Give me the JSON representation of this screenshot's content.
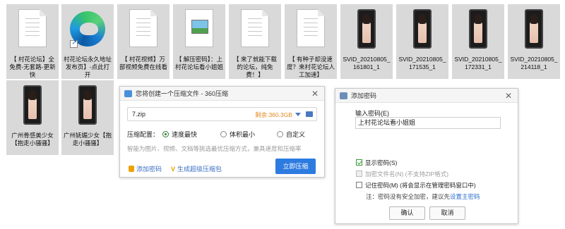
{
  "files": [
    {
      "label": "【 村花论坛】全免费-无套路-更新快",
      "kind": "doc"
    },
    {
      "label": "村花论坛永久地址发布页】-点此打开",
      "kind": "edge"
    },
    {
      "label": "【 村花视频】万部视频免费在线看",
      "kind": "doc"
    },
    {
      "label": "【 解压密码】：上村花论坛看小姐姐",
      "kind": "image"
    },
    {
      "label": "【 来了就能下载的论坛，纯免费！】",
      "kind": "doc"
    },
    {
      "label": "【 有种子却没速度？来村花论坛人工加速】",
      "kind": "doc"
    },
    {
      "label": "SVID_20210805_161801_1",
      "kind": "video"
    },
    {
      "label": "SVID_20210805_171535_1",
      "kind": "video"
    },
    {
      "label": "SVID_20210805_172331_1",
      "kind": "video"
    },
    {
      "label": "SVID_20210805_214118_1",
      "kind": "video"
    },
    {
      "label": "广州骨感美少女【抱走小骚骚】",
      "kind": "video"
    },
    {
      "label": "广州妩媚少女【抱走小骚骚】",
      "kind": "video"
    }
  ],
  "zip_dialog": {
    "title": "您将创建一个压缩文件 - 360压缩",
    "filename": "7.zip",
    "free_space": "剩余:360.3GB",
    "config_label": "压缩配置：",
    "options": [
      "速度最快",
      "体积最小",
      "自定义"
    ],
    "selected_option": "速度最快",
    "hint": "智能为图片、视频、文档等挑选最优压缩方式，兼具速度和压缩率",
    "add_password": "添加密码",
    "super_zip": "生成超级压缩包",
    "compress_button": "立即压缩"
  },
  "pw_dialog": {
    "title": "添加密码",
    "input_label": "输入密码(E)",
    "password": "上村花论坛看小姐姐",
    "show_password": "显示密码(S)",
    "show_password_checked": true,
    "encrypt_names": "加密文件名(N) (不支持ZIP格式)",
    "remember": "记住密码(M) (将会显示在管理密码窗口中)",
    "note": "注：密码没有安全加密，建议先",
    "manage_link": "设置主密码",
    "ok": "确认",
    "cancel": "取消"
  }
}
